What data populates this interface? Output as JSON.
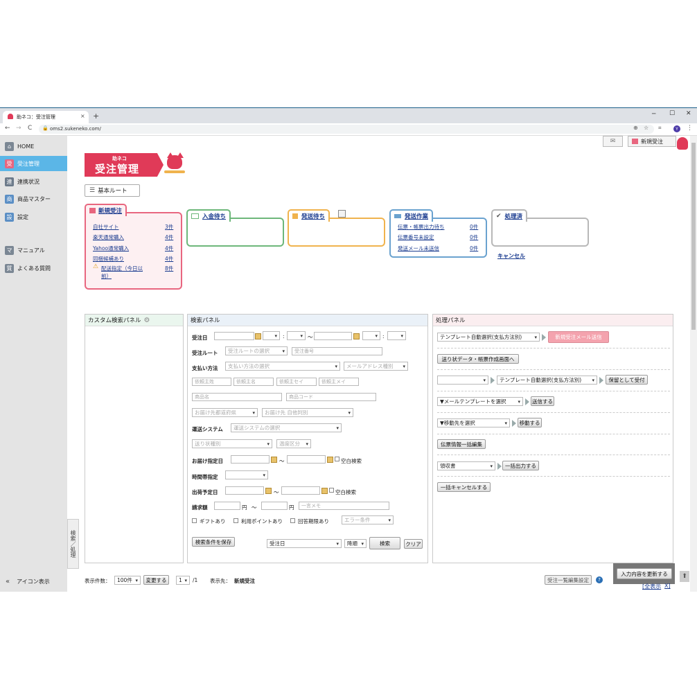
{
  "browser": {
    "tab_title": "助ネコ：受注管理",
    "url": "oms2.sukeneko.com/",
    "new_tab": "+",
    "avatar_letter": "Y"
  },
  "header": {
    "logo_small": "助ネコ",
    "logo_big": "受注管理",
    "new_order_button": "新規受注",
    "route_button": "基本ルート"
  },
  "sidebar": {
    "items": [
      {
        "icon": "家",
        "label": "HOME"
      },
      {
        "icon": "受",
        "label": "受注管理"
      },
      {
        "icon": "連",
        "label": "連携状況"
      },
      {
        "icon": "商",
        "label": "商品マスター"
      },
      {
        "icon": "設",
        "label": "設定"
      },
      {
        "icon": "マ",
        "label": "マニュアル"
      },
      {
        "icon": "質",
        "label": "よくある質問"
      }
    ],
    "collapse_label": "アイコン表示",
    "side_tab_label": "検索／処理"
  },
  "status_cards": {
    "new": {
      "title": "新規受注",
      "rows": [
        {
          "label": "自社サイト",
          "count": "3件"
        },
        {
          "label": "楽天通常購入",
          "count": "4件"
        },
        {
          "label": "Yahoo通常購入",
          "count": "4件"
        },
        {
          "label": "同梱候補あり",
          "count": "4件"
        },
        {
          "label": "配送指定（今日以前）",
          "count": "8件"
        }
      ]
    },
    "payment": {
      "title": "入金待ち"
    },
    "shipping_wait": {
      "title": "発送待ち"
    },
    "shipping_work": {
      "title": "発送作業",
      "rows": [
        {
          "label": "伝票・帳票出力待ち",
          "count": "0件"
        },
        {
          "label": "伝票番号未設定",
          "count": "0件"
        },
        {
          "label": "発送メール未送信",
          "count": "0件"
        }
      ]
    },
    "done": {
      "title": "処理済",
      "cancel": "キャンセル"
    }
  },
  "custom_panel": {
    "title": "カスタム検索パネル"
  },
  "search_panel": {
    "title": "検索パネル",
    "order_date": "受注日",
    "tilde": "〜",
    "colon": ":",
    "route_label": "受注ルート",
    "route_placeholder": "受注ルートの選択",
    "order_no_placeholder": "受注番号",
    "payment_label": "支払い方法",
    "payment_placeholder": "支払い方法の選択",
    "mail_type_placeholder": "メールアドレス種別",
    "client_last": "依頼主姓",
    "client_first": "依頼主名",
    "client_last_kana": "依頼主セイ",
    "client_first_kana": "依頼主メイ",
    "product_name": "商品名",
    "product_code": "商品コード",
    "pref_placeholder": "お届け先都道府県",
    "dest_type_placeholder": "お届け先 自他判別",
    "carrier_label": "運送システム",
    "carrier_placeholder": "運送システムの選択",
    "slip_type_placeholder": "送り状種別",
    "temp_placeholder": "温度区分",
    "delivery_date_label": "お届け指定日",
    "blank_search": "空白検索",
    "time_label": "時間帯指定",
    "ship_date_label": "出荷予定日",
    "amount_label": "請求額",
    "yen": "円",
    "memo_placeholder": "一言メモ",
    "gift": "ギフトあり",
    "points": "利用ポイントあり",
    "deadline": "回答期限あり",
    "error_placeholder": "エラー条件",
    "save_condition": "検索条件を保存",
    "sort_field": "受注日",
    "sort_order": "降順",
    "search_button": "検索",
    "clear_button": "クリア"
  },
  "process_panel": {
    "title": "処理パネル",
    "template_select": "テンプレート自動選択(支払方法別)",
    "send_new_mail": "新規受注メール送信",
    "slip_screen": "送り状データ・帳票作成画面へ",
    "template_select2": "テンプレート自動選択(支払方法別)",
    "hold_accept": "保留として受付",
    "mail_template": "▼メールテンプレートを選択",
    "send": "送信する",
    "move_target": "▼移動先を選択",
    "move": "移動する",
    "bulk_slip_edit": "伝票情報一括編集",
    "receipt": "領収書",
    "bulk_output": "一括出力する",
    "bulk_cancel": "一括キャンセルする"
  },
  "footer": {
    "count_label": "表示件数：",
    "count_value": "100件",
    "change_button": "変更する",
    "page_value": "1",
    "page_total": "/1",
    "dest_label": "表示先：",
    "dest_value": "新規受注",
    "list_settings": "受注一覧編集設定",
    "update_button": "入力内容を更新する",
    "show_all": "[全表示",
    "close_x": "X]"
  },
  "colors": {
    "new": "#e8667f",
    "payment": "#6db77a",
    "shipping_wait": "#f0b34d",
    "shipping_work": "#6aa2cf",
    "done": "#b8b8b8",
    "active_nav": "#5bb6e7",
    "logo_bg": "#e03a58"
  }
}
